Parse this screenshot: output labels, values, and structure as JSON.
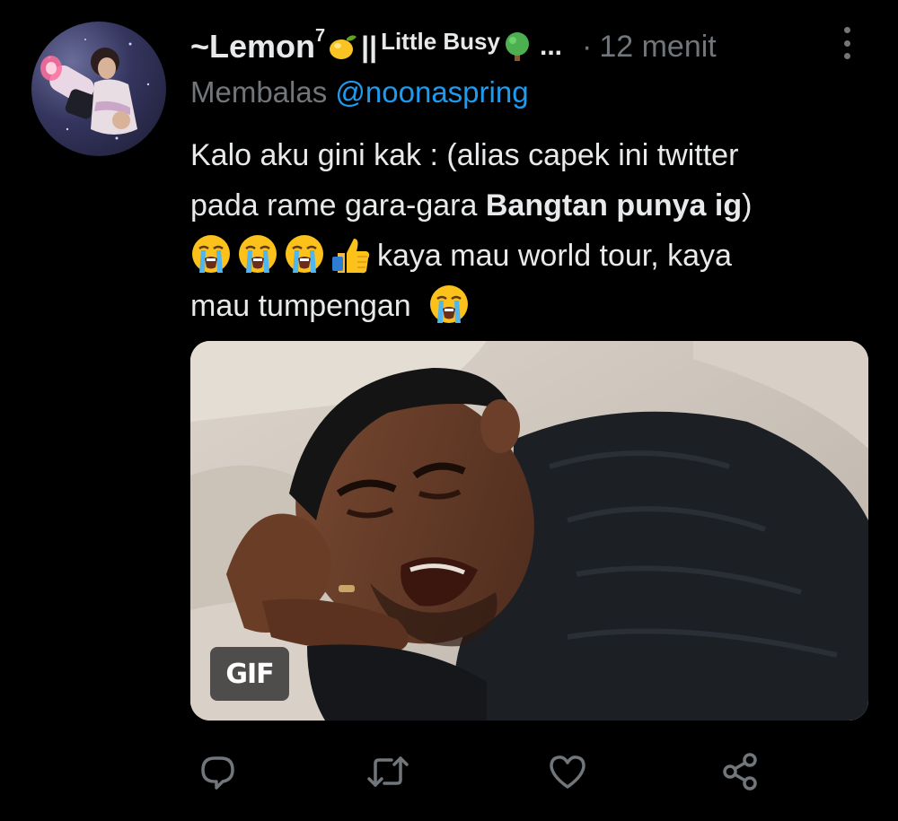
{
  "tweet": {
    "display_name": "~Lemon",
    "name_superscript": "7",
    "name_separator": "||",
    "name_suffix": "Little Busy",
    "name_ellipsis": "...",
    "dot": "·",
    "timestamp": "12 menit",
    "replying_prefix": "Membalas",
    "replying_handle": "@noonaspring",
    "text": {
      "line1": "Kalo aku gini kak : (alias capek ini twitter",
      "line2_start": "pada rame gara-gara ",
      "line2_bold": "Bangtan punya ig",
      "line2_end": ")",
      "line3_text": "kaya mau world tour, kaya",
      "line4_text": "mau tumpengan"
    },
    "media": {
      "badge": "GIF"
    }
  },
  "icons": {
    "more": "more-vertical-icon",
    "reply": "reply-icon",
    "retweet": "retweet-icon",
    "like": "heart-icon",
    "share": "share-icon",
    "emoji_lemon": "lemon-emoji-icon",
    "emoji_tree": "tree-emoji-icon",
    "emoji_crying": "loudly-crying-face-emoji-icon",
    "emoji_thumbs": "thumbs-up-emoji-icon"
  },
  "colors": {
    "background": "#000000",
    "text_primary": "#e7e9ea",
    "text_secondary": "#71767b",
    "accent": "#1d9bf0"
  }
}
